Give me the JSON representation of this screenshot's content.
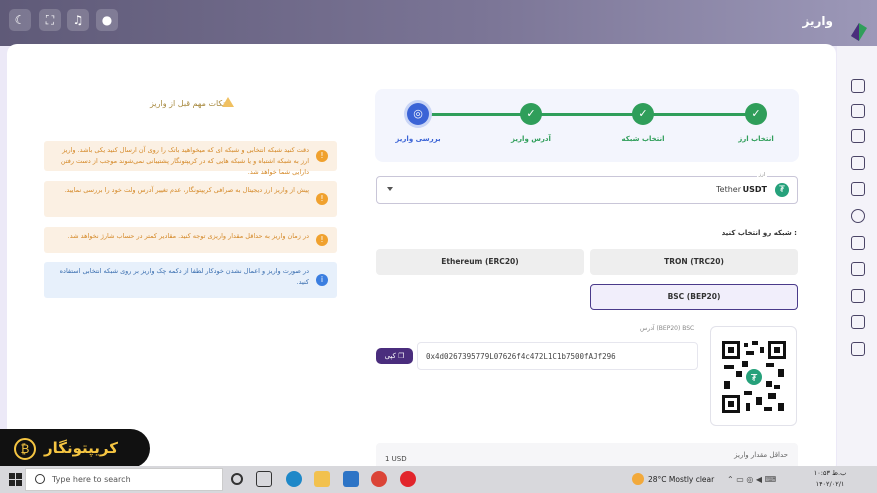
{
  "header": {
    "title": "واریز",
    "icons": [
      "dark-mode-icon",
      "fullscreen-icon",
      "notification-icon",
      "profile-icon"
    ]
  },
  "sidebar": {
    "icons": [
      "dashboard-icon",
      "orders-icon",
      "users-icon",
      "wallet-icon",
      "trade-icon",
      "deposit-icon",
      "withdraw-icon",
      "transfer-icon",
      "gift-icon",
      "report-icon",
      "logout-icon"
    ]
  },
  "notes": {
    "title": "نکات مهم قبل از واریز",
    "items": [
      {
        "text": "دقت کنید شبکه انتخابی و شبکه ای که میخواهید باتک را روی آن ارسال کنید یکی باشد. واریز ارز به شبکه اشتباه و یا شبکه هایی که در کریپتونگار پشتیبانی نمی‌شوند موجب از دست رفتن دارایی شما خواهد شد.",
        "style": "orange"
      },
      {
        "text": "پیش از واریز ارز دیجیتال به صرافی کریپتونگار، عدم تغییر آدرس ولت خود را بررسی نمایید.",
        "style": "orange"
      },
      {
        "text": "در زمان واریز به حداقل مقدار واریزی توجه کنید. مقادیر کمتر در حساب شارژ نخواهد شد.",
        "style": "orange"
      },
      {
        "text": "در صورت واریز و اعمال نشدن خودکار لطفا از دکمه چک واریز بر روی شبکه انتخابی استفاده کنید.",
        "style": "blue"
      }
    ]
  },
  "stepper": {
    "steps": [
      {
        "label": "انتخاب ارز",
        "status": "done"
      },
      {
        "label": "انتخاب شبکه",
        "status": "done"
      },
      {
        "label": "آدرس واریز",
        "status": "done"
      },
      {
        "label": "بررسی واریز",
        "status": "current"
      }
    ]
  },
  "currency": {
    "floating_label": "ارز",
    "code": "USDT",
    "name": "Tether"
  },
  "network": {
    "label": "شبکه رو انتخاب کنید :",
    "options": [
      {
        "label": "TRON (TRC20)",
        "selected": false
      },
      {
        "label": "Ethereum (ERC20)",
        "selected": false
      },
      {
        "label": "BSC (BEP20)",
        "selected": true
      }
    ]
  },
  "address": {
    "label": "آدرس (BEP20) BSC",
    "value": "0x4d0267395779L07626f4c472L1C1b7500fAJf296",
    "copy_label": "کپی"
  },
  "minimum": {
    "label": "حداقل مقدار واریز",
    "value": "1 USD"
  },
  "brand": {
    "name": "کریپتونگار"
  },
  "taskbar": {
    "search_placeholder": "Type here to search",
    "weather": "28°C  Mostly clear",
    "time": "ب.ظ ۱۰:۵۳",
    "date": "۱۴۰۲/۰۲/۱"
  },
  "colors": {
    "accent": "#4a2d7d",
    "step_done": "#2f9e5a",
    "step_current": "#3a63d6",
    "warning_bg": "#fbf0e3",
    "info_bg": "#e7f0fb"
  }
}
